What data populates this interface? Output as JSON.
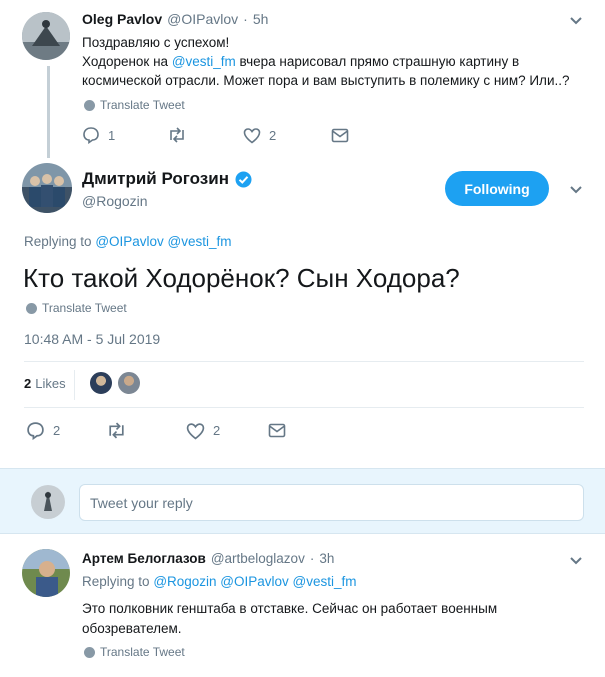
{
  "tweet1": {
    "author_name": "Oleg Pavlov",
    "handle": "@OIPavlov",
    "time": "5h",
    "line1": "Поздравляю с успехом!",
    "line2_pre": "Ходоренок на ",
    "line2_mention": "@vesti_fm",
    "line2_post": " вчера нарисовал прямо страшную картину в",
    "line3": "космической отрасли. Может пора и вам выступить в полемику с ним? Или..?",
    "translate": "Translate Tweet",
    "reply_count": "1",
    "like_count": "2"
  },
  "main_tweet": {
    "author_name": "Дмитрий Рогозин",
    "handle": "@Rogozin",
    "follow_label": "Following",
    "replying_label": "Replying to",
    "replying_mentions": "@OIPavlov @vesti_fm",
    "text": "Кто такой Ходорёнок? Сын Ходора?",
    "translate": "Translate Tweet",
    "timestamp": "10:48 AM - 5 Jul 2019",
    "likes_count": "2",
    "likes_label": "Likes",
    "reply_count": "2",
    "like_count": "2"
  },
  "reply_box": {
    "placeholder": "Tweet your reply"
  },
  "tweet3": {
    "author_name": "Артем Белоглазов",
    "handle": "@artbeloglazov",
    "time": "3h",
    "replying_label": "Replying to",
    "replying_mentions": "@Rogozin @OIPavlov @vesti_fm",
    "line1": "Это полковник генштаба в отставке. Сейчас он работает военным",
    "line2": "обозревателем.",
    "translate": "Translate Tweet"
  },
  "colors": {
    "accent": "#1da1f2",
    "link": "#1b95e0",
    "muted": "#657786",
    "verified": "#1da1f2"
  }
}
